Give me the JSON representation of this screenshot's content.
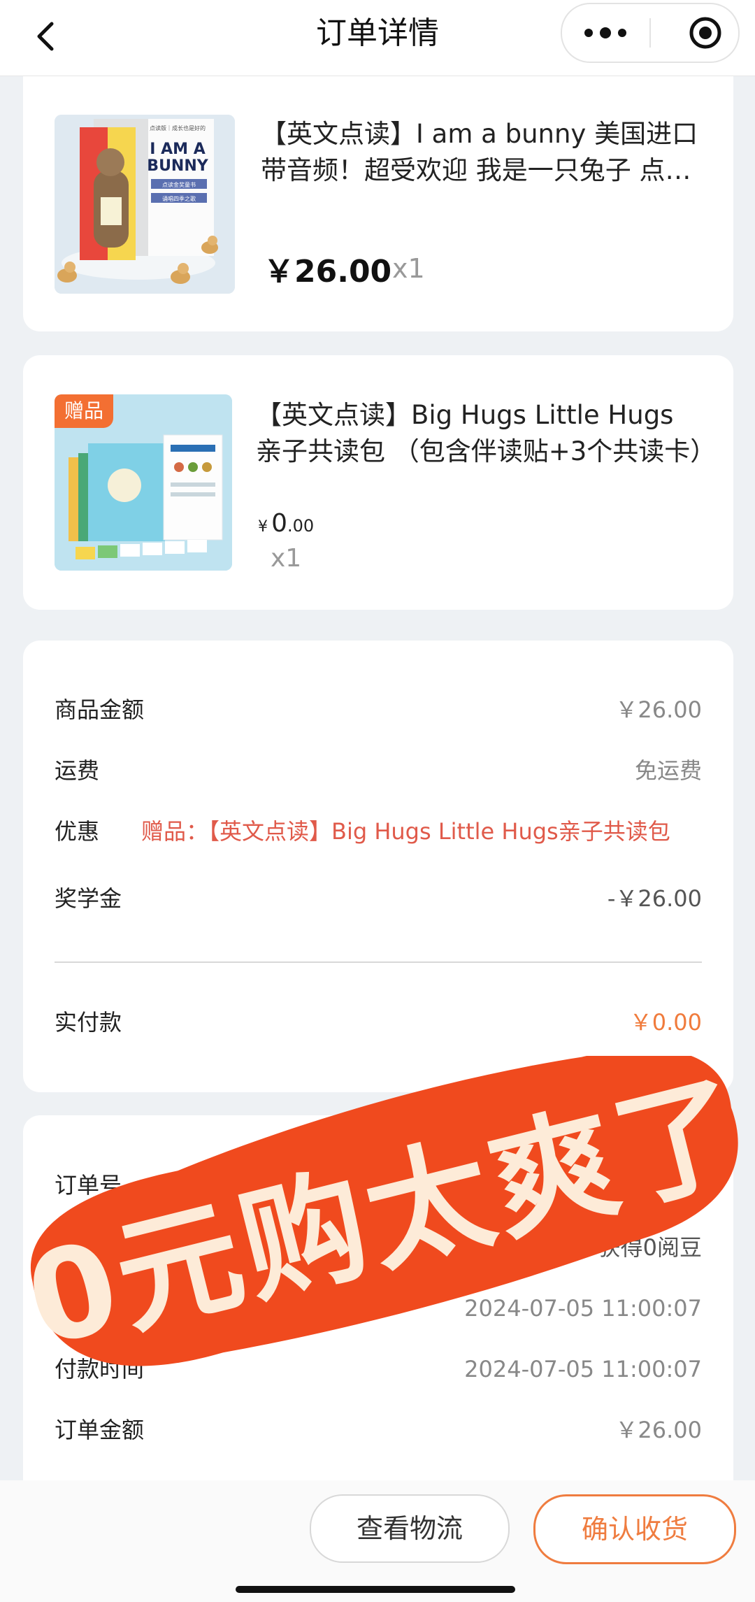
{
  "navbar": {
    "title": "订单详情",
    "back_icon": "chevron-left-icon",
    "more_icon": "more-dots-icon",
    "capsule_icon": "target-icon"
  },
  "product1": {
    "title": "【英文点读】I am a bunny 美国进口 带音频！超受欢迎 我是一只兔子 点读金奖童书",
    "price": "￥26.00",
    "qty": "x1",
    "cover": {
      "top_text": "点读版｜成长也是好的",
      "title_line1": "I AM A",
      "title_line2": "BUNNY",
      "tag1": "点读金奖童书",
      "tag2": "诵唱四季之歌"
    }
  },
  "product2": {
    "badge": "赠品",
    "title": "【英文点读】Big Hugs Little Hugs 亲子共读包 （包含伴读贴+3个共读卡）",
    "price_currency": "¥",
    "price_int": "0",
    "price_dec": ".00",
    "qty": "x1"
  },
  "summary": {
    "goods_amount_label": "商品金额",
    "goods_amount_value": "￥26.00",
    "shipping_label": "运费",
    "shipping_value": "免运费",
    "discount_label": "优惠",
    "discount_value": "赠品：【英文点读】Big Hugs Little Hugs亲子共读包",
    "scholarship_label": "奖学金",
    "scholarship_value": "-￥26.00",
    "paid_label": "实付款",
    "paid_value": "￥0.00"
  },
  "order_info": {
    "order_no_label": "订单号",
    "reward_value": "获得0阅豆",
    "created_time_value": "2024-07-05 11:00:07",
    "paid_time_label": "付款时间",
    "paid_time_value": "2024-07-05 11:00:07",
    "order_amount_label": "订单金额",
    "order_amount_value": "￥26.00"
  },
  "sticker": {
    "text": "0元购太爽了",
    "color": "#f04a1e",
    "text_color": "#fdebd8"
  },
  "actions": {
    "logistics_label": "查看物流",
    "confirm_label": "确认收货"
  },
  "colors": {
    "accent_orange": "#ef7c3f",
    "promo_red": "#e05a4a",
    "badge_orange": "#f36f32"
  }
}
